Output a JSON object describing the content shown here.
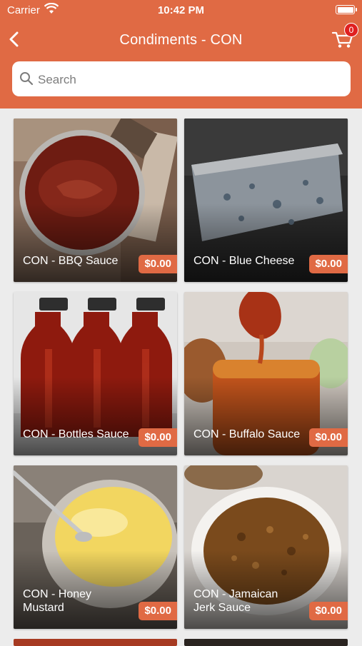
{
  "status_bar": {
    "carrier": "Carrier",
    "time": "10:42 PM"
  },
  "nav": {
    "title": "Condiments - CON",
    "cart_count": "0"
  },
  "search": {
    "placeholder": "Search"
  },
  "products": [
    {
      "name": "CON - BBQ Sauce",
      "price": "$0.00",
      "image": "bbq-sauce-pot"
    },
    {
      "name": "CON - Blue Cheese",
      "price": "$0.00",
      "image": "blue-cheese-wedge"
    },
    {
      "name": "CON - Bottles Sauce",
      "price": "$0.00",
      "image": "sauce-bottles"
    },
    {
      "name": "CON - Buffalo Sauce",
      "price": "$0.00",
      "image": "buffalo-sauce-jar"
    },
    {
      "name": "CON - Honey Mustard",
      "price": "$0.00",
      "image": "honey-mustard-bowl"
    },
    {
      "name": "CON - Jamaican Jerk Sauce",
      "price": "$0.00",
      "image": "jerk-sauce-bowl"
    }
  ],
  "colors": {
    "accent": "#e06a44",
    "badge": "#e02020",
    "background": "#ececec"
  }
}
